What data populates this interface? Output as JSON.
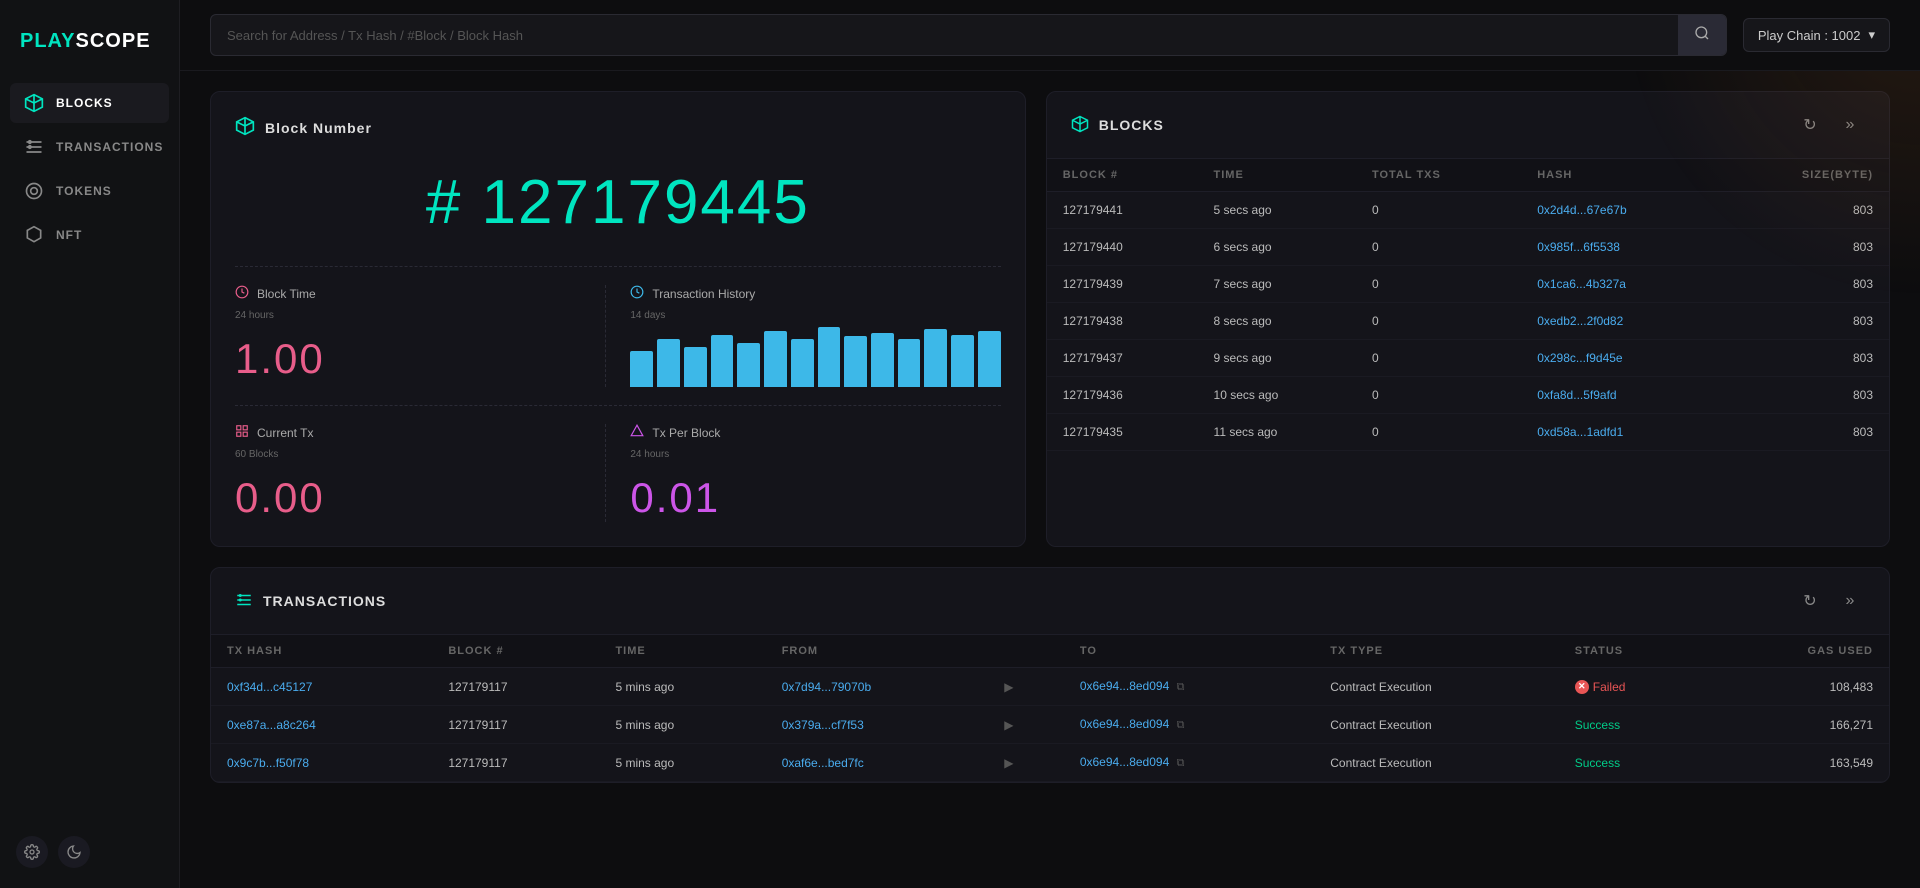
{
  "logo": {
    "play": "PLAY",
    "scope": "SCOPE"
  },
  "sidebar": {
    "items": [
      {
        "id": "blocks",
        "label": "BLOCKS",
        "icon": "⬡",
        "active": true
      },
      {
        "id": "transactions",
        "label": "TRANSACTIONS",
        "icon": "◈"
      },
      {
        "id": "tokens",
        "label": "TOKENS",
        "icon": "◎"
      },
      {
        "id": "nft",
        "label": "NFT",
        "icon": "⬟"
      }
    ],
    "settings_label": "⚙",
    "theme_label": "🌙"
  },
  "header": {
    "search_placeholder": "Search for Address / Tx Hash / #Block / Block Hash",
    "search_icon": "🔍",
    "chain_selector": "Play Chain : 1002",
    "chain_dropdown_icon": "▾"
  },
  "block_number_card": {
    "title": "Block Number",
    "icon": "⬡",
    "value": "# 127179445",
    "block_time": {
      "label": "Block Time",
      "sublabel": "24 hours",
      "icon": "⏱",
      "value": "1.00"
    },
    "tx_history": {
      "label": "Transaction History",
      "sublabel": "14 days",
      "icon": "🕐",
      "bars": [
        40,
        55,
        45,
        60,
        50,
        65,
        55,
        70,
        58,
        62,
        55,
        68,
        60,
        65
      ]
    },
    "current_tx": {
      "label": "Current Tx",
      "sublabel": "60 Blocks",
      "icon": "📊",
      "value": "0.00"
    },
    "tx_per_block": {
      "label": "Tx Per Block",
      "sublabel": "24 hours",
      "icon": "🔷",
      "value": "0.01"
    }
  },
  "blocks_table": {
    "title": "BLOCKS",
    "icon": "⬡",
    "refresh_icon": "↻",
    "forward_icon": "»",
    "columns": [
      "BLOCK #",
      "TIME",
      "TOTAL TXS",
      "HASH",
      "SIZE(BYTE)"
    ],
    "rows": [
      {
        "block": "127179441",
        "time": "5 secs ago",
        "txs": "0",
        "hash": "0x2d4d...67e67b",
        "size": "803"
      },
      {
        "block": "127179440",
        "time": "6 secs ago",
        "txs": "0",
        "hash": "0x985f...6f5538",
        "size": "803"
      },
      {
        "block": "127179439",
        "time": "7 secs ago",
        "txs": "0",
        "hash": "0x1ca6...4b327a",
        "size": "803"
      },
      {
        "block": "127179438",
        "time": "8 secs ago",
        "txs": "0",
        "hash": "0xedb2...2f0d82",
        "size": "803"
      },
      {
        "block": "127179437",
        "time": "9 secs ago",
        "txs": "0",
        "hash": "0x298c...f9d45e",
        "size": "803"
      },
      {
        "block": "127179436",
        "time": "10 secs ago",
        "txs": "0",
        "hash": "0xfa8d...5f9afd",
        "size": "803"
      },
      {
        "block": "127179435",
        "time": "11 secs ago",
        "txs": "0",
        "hash": "0xd58a...1adfd1",
        "size": "803"
      }
    ]
  },
  "transactions_table": {
    "title": "TRANSACTIONS",
    "icon": "◈",
    "refresh_icon": "↻",
    "forward_icon": "»",
    "columns": [
      "TX HASH",
      "BLOCK #",
      "TIME",
      "FROM",
      "",
      "TO",
      "TX TYPE",
      "STATUS",
      "GAS USED"
    ],
    "rows": [
      {
        "hash": "0xf34d...c45127",
        "block": "127179117",
        "time": "5 mins ago",
        "from": "0x7d94...79070b",
        "to": "0x6e94...8ed094",
        "tx_type": "Contract Execution",
        "status": "Failed",
        "gas": "108,483"
      },
      {
        "hash": "0xe87a...a8c264",
        "block": "127179117",
        "time": "5 mins ago",
        "from": "0x379a...cf7f53",
        "to": "0x6e94...8ed094",
        "tx_type": "Contract Execution",
        "status": "Success",
        "gas": "166,271"
      },
      {
        "hash": "0x9c7b...f50f78",
        "block": "127179117",
        "time": "5 mins ago",
        "from": "0xaf6e...bed7fc",
        "to": "0x6e94...8ed094",
        "tx_type": "Contract Execution",
        "status": "Success",
        "gas": "163,549"
      }
    ]
  },
  "colors": {
    "accent": "#00e5c0",
    "pink": "#e85d8a",
    "blue": "#3db8e8",
    "link": "#4aacee",
    "success": "#00cc88",
    "failed": "#e85555",
    "bg": "#0d0d0f",
    "card": "#14141a"
  }
}
